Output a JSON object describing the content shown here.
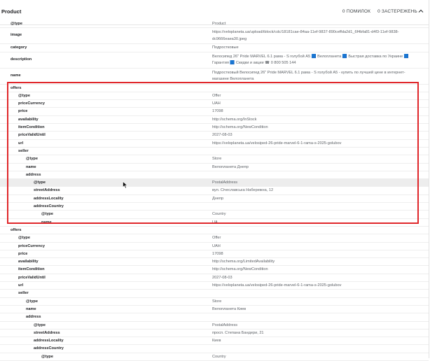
{
  "header": {
    "title": "Product",
    "errors": "0 ПОМИЛОК",
    "warnings": "0 ЗАСТЕРЕЖЕНЬ"
  },
  "rows": [
    {
      "key": "@type",
      "value": "Product",
      "level": 0
    },
    {
      "key": "image",
      "value": "https://veloplaneta.ua/upload/iblock/cdc/18181cae-84aa-11ef-9837-890ceffda2d1_6f4bfa81-d4f3-11ef-9838-dc9666eaea30.jpeg",
      "level": 0,
      "tall": true
    },
    {
      "key": "category",
      "value": "Подростковые",
      "level": 0
    },
    {
      "key": "description",
      "value": "Велосипед 26\" Pride MARVEL 6.1 рама - S голубой А5 🟦 Велопланета 🟦 Быстрая доставка по Украине 🟦 Гарантия 🟦 Скидки и акции ☎ 0 800 505 144",
      "level": 0,
      "tall": true
    },
    {
      "key": "name",
      "value": "Подростковый Велосипед 26\" Pride MARVEL 6.1 рама - S голубой А5 - купить по лучшей цене в интернет-магазине Велопланета",
      "level": 0,
      "tall": true
    },
    {
      "key": "offers",
      "value": "",
      "level": 0
    },
    {
      "key": "@type",
      "value": "Offer",
      "level": 1
    },
    {
      "key": "priceCurrency",
      "value": "UAH",
      "level": 1
    },
    {
      "key": "price",
      "value": "17098",
      "level": 1
    },
    {
      "key": "availability",
      "value": "http://schema.org/InStock",
      "level": 1
    },
    {
      "key": "itemCondition",
      "value": "http://schema.org/NewCondition",
      "level": 1
    },
    {
      "key": "priceValidUntil",
      "value": "2027-08-03",
      "level": 1
    },
    {
      "key": "url",
      "value": "https://veloplaneta.ua/velosiped-26-pride-marvel-6-1-rama-s-2025-golubov",
      "level": 1
    },
    {
      "key": "seller",
      "value": "",
      "level": 1
    },
    {
      "key": "@type",
      "value": "Store",
      "level": 2
    },
    {
      "key": "name",
      "value": "Велопланета Днепр",
      "level": 2
    },
    {
      "key": "address",
      "value": "",
      "level": 2
    },
    {
      "key": "@type",
      "value": "PostalAddress",
      "level": 3,
      "highlight": true
    },
    {
      "key": "streetAddress",
      "value": "вул. Січеславська Набережна, 12",
      "level": 3
    },
    {
      "key": "addressLocality",
      "value": "Днепр",
      "level": 3
    },
    {
      "key": "addressCountry",
      "value": "",
      "level": 3
    },
    {
      "key": "@type",
      "value": "Country",
      "level": 4
    },
    {
      "key": "name",
      "value": "UA",
      "level": 4
    },
    {
      "key": "offers",
      "value": "",
      "level": 0
    },
    {
      "key": "@type",
      "value": "Offer",
      "level": 1
    },
    {
      "key": "priceCurrency",
      "value": "UAH",
      "level": 1
    },
    {
      "key": "price",
      "value": "17098",
      "level": 1
    },
    {
      "key": "availability",
      "value": "http://schema.org/LimitedAvailability",
      "level": 1
    },
    {
      "key": "itemCondition",
      "value": "http://schema.org/NewCondition",
      "level": 1
    },
    {
      "key": "priceValidUntil",
      "value": "2027-08-03",
      "level": 1
    },
    {
      "key": "url",
      "value": "https://veloplaneta.ua/velosiped-26-pride-marvel-6-1-rama-s-2025-golubov",
      "level": 1
    },
    {
      "key": "seller",
      "value": "",
      "level": 1
    },
    {
      "key": "@type",
      "value": "Store",
      "level": 2
    },
    {
      "key": "name",
      "value": "Велопланета Киев",
      "level": 2
    },
    {
      "key": "address",
      "value": "",
      "level": 2
    },
    {
      "key": "@type",
      "value": "PostalAddress",
      "level": 3
    },
    {
      "key": "streetAddress",
      "value": "просп. Степана Бандери, 21",
      "level": 3
    },
    {
      "key": "addressLocality",
      "value": "Киев",
      "level": 3
    },
    {
      "key": "addressCountry",
      "value": "",
      "level": 3
    },
    {
      "key": "@type",
      "value": "Country",
      "level": 4
    }
  ],
  "colors": {
    "selection_border": "#e0262a",
    "highlight_row": "#ededed"
  }
}
